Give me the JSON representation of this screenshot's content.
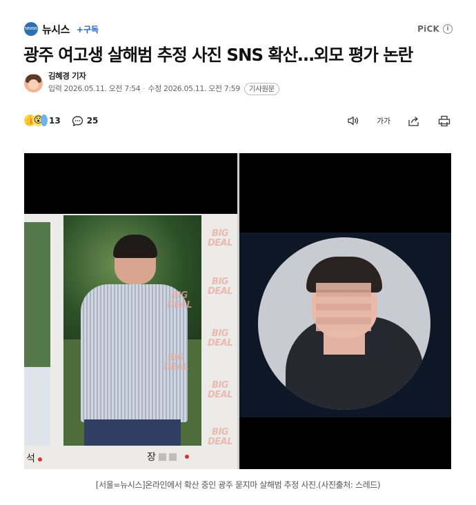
{
  "header": {
    "brand_logo_text": "NEWSIS",
    "brand_name": "뉴시스",
    "subscribe_label": "+구독",
    "pick_label": "PiCK",
    "info_icon": "info-icon"
  },
  "article": {
    "headline": "광주 여고생 살해범 추정 사진 SNS 확산…외모 평가 논란",
    "author": "김혜경 기자",
    "published": "입력 2026.05.11. 오전 7:54",
    "modified": "수정 2026.05.11. 오전 7:59",
    "original_label": "기사원문"
  },
  "actions": {
    "reaction_count": "13",
    "comment_count": "25",
    "font_size_label": "가가",
    "icons": [
      "audio-icon",
      "font-size-icon",
      "share-icon",
      "print-icon"
    ]
  },
  "photo": {
    "watermark_line1": "BIG",
    "watermark_line2": "DEAL",
    "name_left": "석",
    "name_right": "장"
  },
  "caption": "[서울=뉴시스]온라인에서 확산 중인 광주 묻지마 살해범 추정 사진.(사진출처: 스레드)"
}
